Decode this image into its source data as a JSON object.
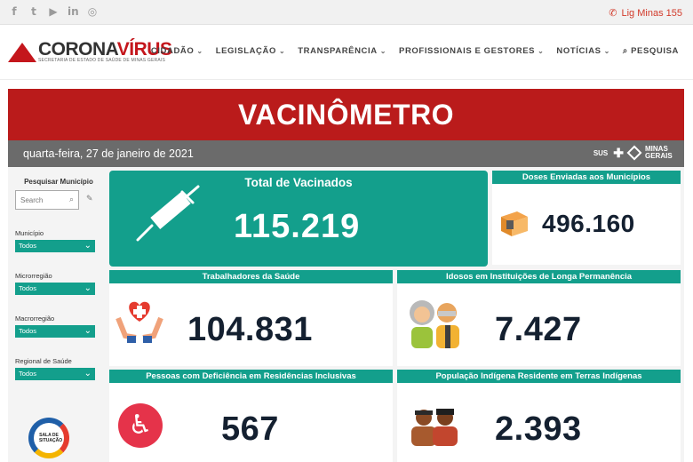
{
  "social": {
    "icons": [
      "facebook-icon",
      "twitter-icon",
      "youtube-icon",
      "linkedin-icon",
      "instagram-icon"
    ],
    "glyphs": [
      "f",
      "t",
      "▶",
      "in",
      "◎"
    ]
  },
  "contact": {
    "phone_label": "Lig Minas 155"
  },
  "header": {
    "brand_left": "CORONA",
    "brand_right": "VÍRUS",
    "brand_sub": "SECRETARIA DE ESTADO DE SAÚDE DE MINAS GERAIS",
    "nav": [
      "CIDADÃO",
      "LEGISLAÇÃO",
      "TRANSPARÊNCIA",
      "PROFISSIONAIS E GESTORES",
      "NOTÍCIAS"
    ],
    "search_label": "PESQUISA"
  },
  "dashboard": {
    "title": "VACINÔMETRO",
    "date": "quarta-feira, 27 de janeiro de 2021",
    "partner_sus": "SUS",
    "partner_mg": "MINAS GERAIS",
    "filters": {
      "search_title": "Pesquisar Município",
      "search_placeholder": "Search",
      "items": [
        {
          "label": "Município",
          "value": "Todos"
        },
        {
          "label": "Microrregião",
          "value": "Todos"
        },
        {
          "label": "Macrorregião",
          "value": "Todos"
        },
        {
          "label": "Regional de Saúde",
          "value": "Todos"
        }
      ],
      "sala_label": "SALA DE SITUAÇÃO"
    },
    "cards": {
      "total": {
        "title": "Total de Vacinados",
        "value": "115.219"
      },
      "doses": {
        "title": "Doses Enviadas aos Municípios",
        "value": "496.160"
      },
      "saude": {
        "title": "Trabalhadores da Saúde",
        "value": "104.831"
      },
      "idosos": {
        "title": "Idosos em Instituições de Longa Permanência",
        "value": "7.427"
      },
      "deficiencia": {
        "title": "Pessoas com Deficiência em Residências Inclusivas",
        "value": "567"
      },
      "indigena": {
        "title": "População Indígena Residente em Terras Indígenas",
        "value": "2.393"
      }
    },
    "colors": {
      "teal": "#139f8c",
      "red": "#ba1b1b",
      "dark": "#142030"
    }
  }
}
